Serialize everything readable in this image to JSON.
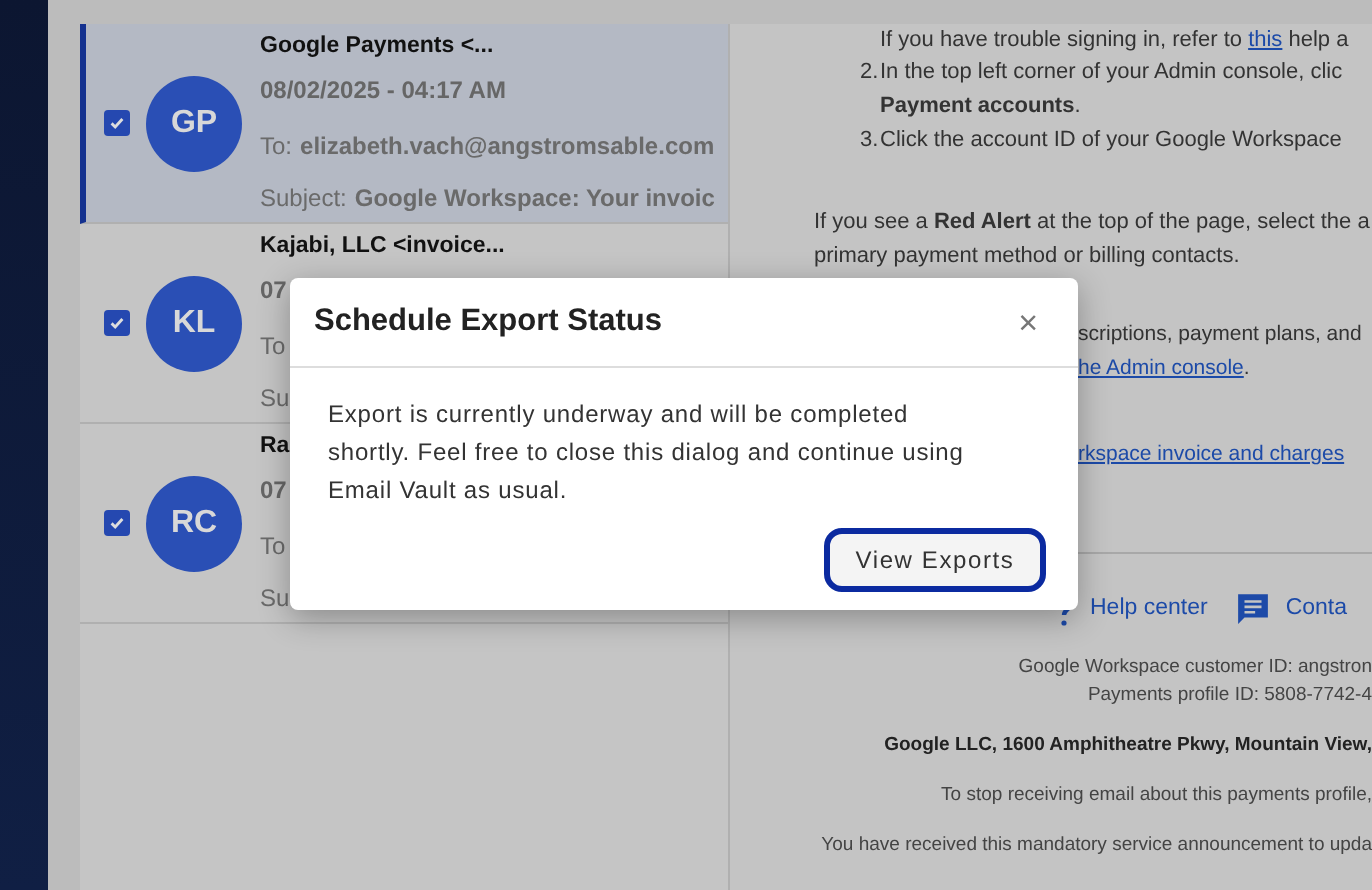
{
  "messages": [
    {
      "initials": "GP",
      "selected": true,
      "checked": true,
      "sender": "Google Payments <...",
      "date": "08/02/2025 - 04:17 AM",
      "to_label": "To:",
      "to": "elizabeth.vach@angstromsable.com",
      "subject_label": "Subject:",
      "subject": "Google Workspace: Your invoic"
    },
    {
      "initials": "KL",
      "selected": false,
      "checked": true,
      "sender": "Kajabi, LLC <invoice...",
      "date": "07",
      "to_label": "To",
      "subject_label": "Su"
    },
    {
      "initials": "RC",
      "selected": false,
      "checked": true,
      "sender": "Ra",
      "date": "07",
      "to_label": "To",
      "subject_label": "Su"
    }
  ],
  "email_body": {
    "steps_top": [
      {
        "text": "If you have trouble signing in, refer to ",
        "kind": "text"
      },
      {
        "text": "this",
        "kind": "link"
      },
      {
        "text": " help a",
        "kind": "text"
      }
    ],
    "steps": [
      {
        "number": "2.",
        "lines": [
          "In the top left corner of your Admin console, clic",
          "**Payment accounts**."
        ]
      },
      {
        "number": "3.",
        "lines": [
          "Click the account ID of your Google Workspace"
        ]
      }
    ],
    "alert_lines": [
      "If you see a **Red Alert** at the top of the page, select the a",
      "primary payment method or billing contacts."
    ],
    "partial_lines": [
      {
        "text": "scriptions, payment plans, and",
        "kind": "text"
      },
      {
        "text": "he Admin console",
        "suffix": ".",
        "kind": "link"
      },
      {
        "text": "rkspace invoice and charges",
        "kind": "link"
      }
    ],
    "help_links": [
      {
        "label": "Help center",
        "kind": "help"
      },
      {
        "label": "Conta",
        "kind": "chat"
      }
    ],
    "footer_lines": [
      {
        "text": "Google Workspace customer ID: angstron",
        "bold": false
      },
      {
        "text": "Payments profile ID: 5808-7742-4",
        "bold": false
      },
      {
        "text": "Google LLC, 1600 Amphitheatre Pkwy, Mountain View,",
        "bold": true
      },
      {
        "text": "To stop receiving email about this payments profile,",
        "bold": false
      },
      {
        "text": "You have received this mandatory service announcement to upda",
        "bold": false
      }
    ]
  },
  "dialog": {
    "title": "Schedule Export Status",
    "close": "×",
    "message": "Export is currently underway and will be completed shortly. Feel free to close this dialog and continue using Email Vault as usual.",
    "button": "View Exports"
  }
}
